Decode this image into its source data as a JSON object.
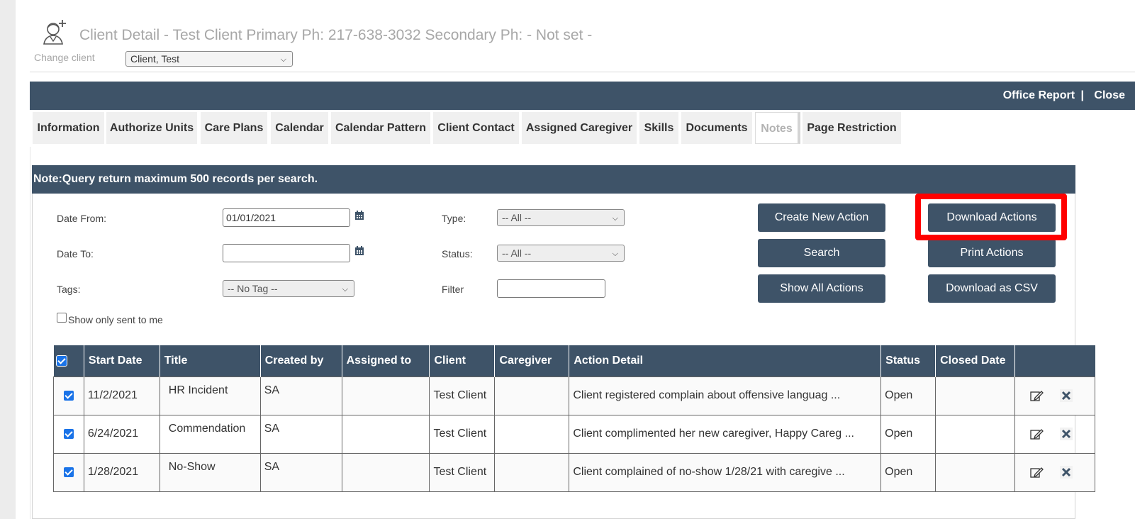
{
  "header": {
    "title": "Client Detail - Test Client Primary Ph: 217-638-3032 Secondary Ph: - Not set -",
    "change_client_label": "Change client",
    "client_select_value": "Client, Test"
  },
  "topbar": {
    "office_report": "Office Report",
    "separator": "|",
    "close": "Close"
  },
  "tabs": [
    {
      "label": "Information"
    },
    {
      "label": "Authorize Units"
    },
    {
      "label": "Care Plans"
    },
    {
      "label": "Calendar"
    },
    {
      "label": "Calendar Pattern"
    },
    {
      "label": "Client Contact"
    },
    {
      "label": "Assigned Caregiver"
    },
    {
      "label": "Skills"
    },
    {
      "label": "Documents"
    },
    {
      "label": "Notes"
    },
    {
      "label": "Page Restriction"
    }
  ],
  "active_tab": "Notes",
  "note": "Note:Query return maximum 500 records per search.",
  "filters": {
    "date_from_label": "Date From:",
    "date_from_value": "01/01/2021",
    "date_to_label": "Date To:",
    "date_to_value": "",
    "tags_label": "Tags:",
    "tags_value": "-- No Tag --",
    "type_label": "Type:",
    "type_value": "-- All --",
    "status_label": "Status:",
    "status_value": "-- All --",
    "filter_label": "Filter",
    "filter_value": "",
    "show_only_sent_label": "Show only sent to me"
  },
  "buttons": {
    "create_new_action": "Create New Action",
    "download_actions": "Download Actions",
    "search": "Search",
    "print_actions": "Print Actions",
    "show_all_actions": "Show All Actions",
    "download_csv": "Download as CSV"
  },
  "table": {
    "columns": [
      "Start Date",
      "Title",
      "Created by",
      "Assigned to",
      "Client",
      "Caregiver",
      "Action Detail",
      "Status",
      "Closed Date"
    ],
    "rows": [
      {
        "start_date": "11/2/2021",
        "title": "HR Incident",
        "created_by": "SA",
        "assigned_to": "",
        "client": "Test Client",
        "caregiver": "",
        "detail": "Client registered complain about offensive languag ...",
        "status": "Open",
        "closed_date": ""
      },
      {
        "start_date": "6/24/2021",
        "title": "Commendation",
        "created_by": "SA",
        "assigned_to": "",
        "client": "Test Client",
        "caregiver": "",
        "detail": "Client complimented her new caregiver, Happy Careg ...",
        "status": "Open",
        "closed_date": ""
      },
      {
        "start_date": "1/28/2021",
        "title": "No-Show",
        "created_by": "SA",
        "assigned_to": "",
        "client": "Test Client",
        "caregiver": "",
        "detail": "Client complained of no-show 1/28/21 with caregive ...",
        "status": "Open",
        "closed_date": ""
      }
    ]
  },
  "colors": {
    "primary": "#3e5368",
    "highlight": "#ff0000",
    "checkbox": "#1a73e8"
  }
}
